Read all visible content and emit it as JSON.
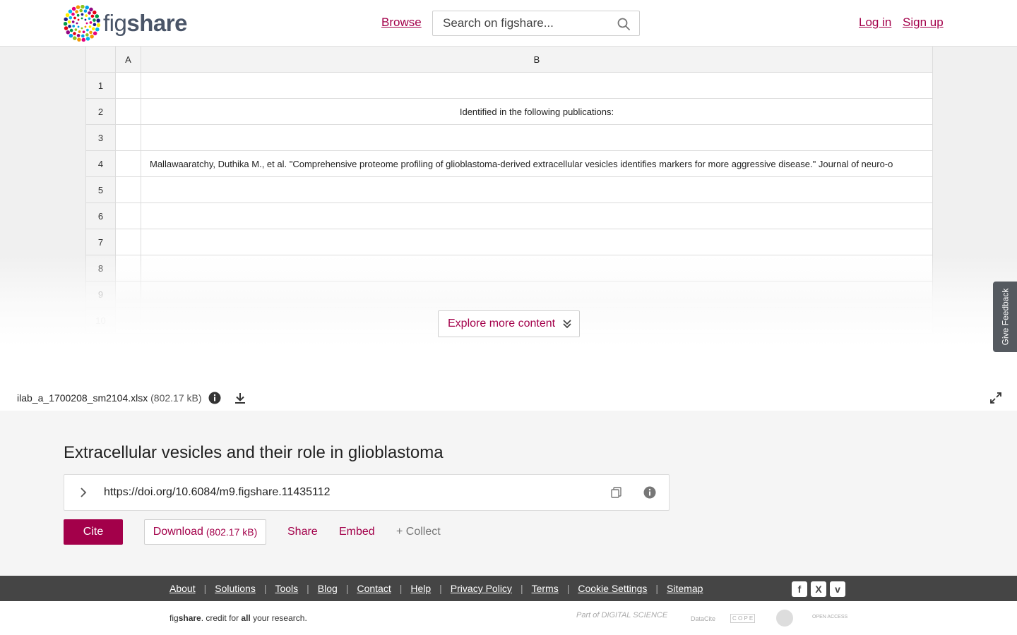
{
  "header": {
    "logo_fig": "fig",
    "logo_share": "share",
    "browse": "Browse",
    "search_placeholder": "Search on figshare...",
    "login": "Log in",
    "signup": "Sign up"
  },
  "sheet": {
    "columns": [
      "A",
      "B"
    ],
    "rows": [
      {
        "num": "1",
        "b": ""
      },
      {
        "num": "2",
        "b": "Identified in the following publications:"
      },
      {
        "num": "3",
        "b": ""
      },
      {
        "num": "4",
        "b": "Mallawaaratchy, Duthika M., et al. \"Comprehensive proteome profiling of glioblastoma-derived extracellular vesicles identifies markers for more aggressive disease.\" Journal of neuro-o"
      },
      {
        "num": "5",
        "b": ""
      },
      {
        "num": "6",
        "b": ""
      },
      {
        "num": "7",
        "b": ""
      },
      {
        "num": "8",
        "b": ""
      },
      {
        "num": "9",
        "b": ""
      },
      {
        "num": "10",
        "b": ""
      }
    ]
  },
  "viewer": {
    "explore_label": "Explore more content",
    "feedback_label": "Give Feedback"
  },
  "file": {
    "name": "ilab_a_1700208_sm2104.xlsx",
    "size": "(802.17 kB)"
  },
  "item": {
    "title": "Extracellular vesicles and their role in glioblastoma",
    "doi": "https://doi.org/10.6084/m9.figshare.11435112",
    "cite": "Cite",
    "download": "Download",
    "download_size": "(802.17 kB)",
    "share": "Share",
    "embed": "Embed",
    "collect": "+ Collect"
  },
  "footer": {
    "links": [
      "About",
      "Solutions",
      "Tools",
      "Blog",
      "Contact",
      "Help",
      "Privacy Policy",
      "Terms",
      "Cookie Settings",
      "Sitemap"
    ],
    "social": [
      "f",
      "X",
      "v"
    ],
    "tagline_fig": "fig",
    "tagline_share": "share",
    "tagline_mid": ". credit for ",
    "tagline_all": "all",
    "tagline_end": " your research.",
    "partners": [
      "Part of DIGITAL SCIENCE",
      "DataCite",
      "C O P E",
      "",
      "OPEN ACCESS"
    ]
  },
  "colors": {
    "brand": "#a3004a",
    "footer_bg": "#454545"
  }
}
